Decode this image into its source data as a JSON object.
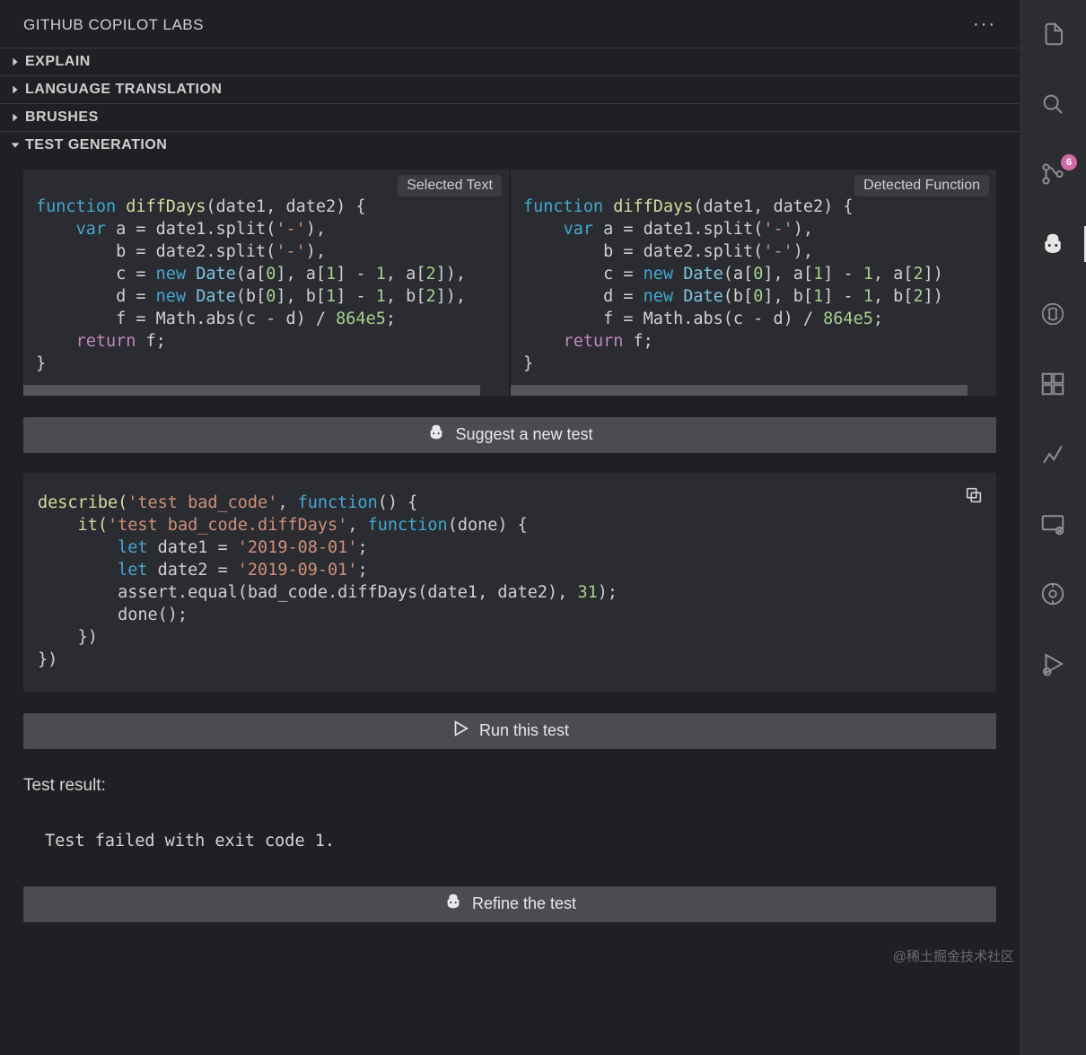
{
  "panel": {
    "title": "GITHUB COPILOT LABS"
  },
  "sections": {
    "explain": "EXPLAIN",
    "language_translation": "LANGUAGE TRANSLATION",
    "brushes": "BRUSHES",
    "test_generation": "TEST GENERATION"
  },
  "code_panes": {
    "left": {
      "tag": "Selected Text",
      "scrollbar_width_pct": 94
    },
    "right": {
      "tag": "Detected Function",
      "scrollbar_width_pct": 94
    },
    "tokens": {
      "kw_function": "function",
      "fn_name": "diffDays",
      "params": "(date1, date2) {",
      "kw_var": "var",
      "a_eq": " a = date1.split(",
      "dash": "'-'",
      "close_comma": "),",
      "b_eq": "b = date2.split(",
      "kw_new": "new",
      "date_cls": " Date",
      "c_eq": "c = ",
      "c_args": "(a[",
      "d_eq": "d = ",
      "d_args": "(b[",
      "idx0": "0",
      "br_comma": "], a[",
      "br_commb": "], b[",
      "idx1": "1",
      "minus": "] - ",
      "one": "1",
      "comma_a2": ", a[",
      "comma_b2": ", b[",
      "idx2": "2",
      "tail": "])",
      "f_eq": "f = Math.abs(c - d) / ",
      "bignum": "864e5",
      "semi": ";",
      "kw_return": "return",
      "ret_f": " f;",
      "brace_close": "}"
    }
  },
  "buttons": {
    "suggest": "Suggest a new test",
    "run": "Run this test",
    "refine": "Refine the test"
  },
  "test_code": {
    "tokens": {
      "describe": "describe(",
      "str_bad_code": "'test bad_code'",
      "comma": ", ",
      "kw_function": "function",
      "paren_open": "() {",
      "it": "it(",
      "str_diffdays": "'test bad_code.diffDays'",
      "done_param": "(done) {",
      "kw_let": "let",
      "date1_eq": " date1 = ",
      "date1_val": "'2019-08-01'",
      "date2_eq": " date2 = ",
      "date2_val": "'2019-09-01'",
      "semi": ";",
      "assert": "assert.equal(bad_code.diffDays(date1, date2), ",
      "thirtyone": "31",
      "close_assert": ");",
      "done": "done();",
      "close_inner": "})",
      "close_outer": "})"
    }
  },
  "test_result": {
    "label": "Test result:",
    "body": "Test failed with exit code 1."
  },
  "activitybar": {
    "badge": "6"
  },
  "watermark": "@稀土掘金技术社区"
}
